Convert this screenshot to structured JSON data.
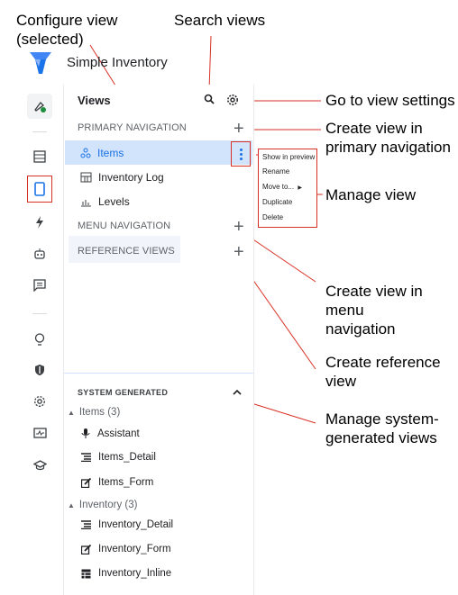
{
  "app": {
    "title": "Simple Inventory"
  },
  "annotations": {
    "configure_view": "Configure view (selected)",
    "search_views": "Search views",
    "go_to_settings": "Go to view settings",
    "create_primary": "Create view in primary navigation",
    "manage_view": "Manage view",
    "create_menu": "Create view in menu navigation",
    "create_reference": "Create reference view",
    "manage_system": "Manage system-generated views"
  },
  "rail": {
    "icons": [
      "rocket-check-icon",
      "table-icon",
      "phone-icon",
      "bolt-icon",
      "bot-icon",
      "chat-icon",
      "lightbulb-icon",
      "shield-icon",
      "gear-icon",
      "monitor-icon",
      "graduation-cap-icon"
    ]
  },
  "views": {
    "title": "Views",
    "primary_header": "PRIMARY NAVIGATION",
    "primary_items": [
      "Items",
      "Inventory Log",
      "Levels"
    ],
    "menu_header": "MENU NAVIGATION",
    "reference_header": "REFERENCE VIEWS",
    "system_header": "SYSTEM GENERATED",
    "groups": [
      {
        "label": "Items (3)",
        "children": [
          "Assistant",
          "Items_Detail",
          "Items_Form"
        ]
      },
      {
        "label": "Inventory (3)",
        "children": [
          "Inventory_Detail",
          "Inventory_Form",
          "Inventory_Inline"
        ]
      }
    ]
  },
  "context_menu": {
    "items": [
      "Show in preview",
      "Rename",
      "Move to...",
      "Duplicate",
      "Delete"
    ]
  },
  "colors": {
    "accent": "#1a73e8",
    "selected_bg": "#d2e3fc",
    "annotation": "#d93025"
  }
}
